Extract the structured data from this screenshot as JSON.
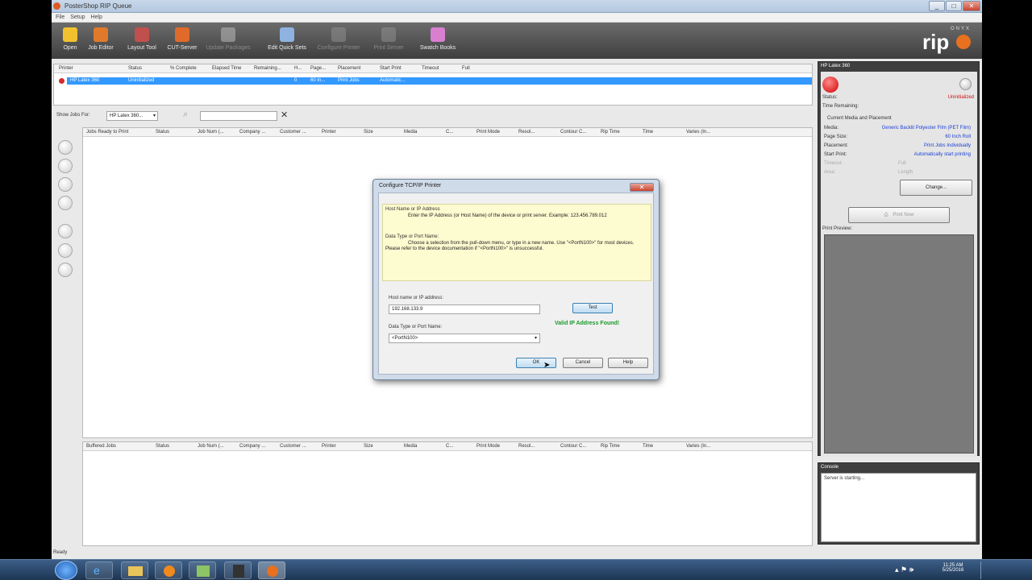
{
  "window": {
    "title": "PosterShop RIP Queue",
    "min": "_",
    "max": "□",
    "close": "✕"
  },
  "menu": [
    "File",
    "Setup",
    "Help"
  ],
  "toolbar": [
    {
      "label": "Open",
      "icon": "folder-icon",
      "color": "#f2c12e",
      "enabled": true
    },
    {
      "label": "Job Editor",
      "icon": "job-editor-icon",
      "color": "#e07a2a",
      "enabled": true
    },
    {
      "label": "Layout Tool",
      "icon": "layout-tool-icon",
      "color": "#c0504d",
      "enabled": true
    },
    {
      "label": "CUT-Server",
      "icon": "cut-server-icon",
      "color": "#e06a2a",
      "enabled": true
    },
    {
      "label": "Update Packages",
      "icon": "update-packages-icon",
      "color": "#cfcfcf",
      "enabled": false
    },
    {
      "label": "Edit Quick Sets",
      "icon": "quick-sets-icon",
      "color": "#8fb3e0",
      "enabled": true
    },
    {
      "label": "Configure Printer",
      "icon": "printer-icon",
      "color": "#9a9a9a",
      "enabled": false
    },
    {
      "label": "Print Server",
      "icon": "print-server-icon",
      "color": "#9a9a9a",
      "enabled": false
    },
    {
      "label": "Swatch Books",
      "icon": "swatch-books-icon",
      "color": "#d87fd0",
      "enabled": true
    }
  ],
  "logo": {
    "brand": "ONYX",
    "product": "rip"
  },
  "printer_table": {
    "headers": [
      "Printer",
      "Status",
      "% Complete",
      "Elapsed Time",
      "Remaining...",
      "H...",
      "Page...",
      "Placement",
      "Start Print",
      "Timeout",
      "Full"
    ],
    "rows": [
      [
        "HP Latex 360",
        "Uninitialized",
        "",
        "",
        "",
        "0",
        "60 In...",
        "Print Jobs",
        "Automatic...",
        "",
        ""
      ]
    ]
  },
  "filter": {
    "label": "Show Jobs For:",
    "selected": "HP Latex 360...",
    "search_value": ""
  },
  "ready_table": {
    "headers": [
      "Jobs Ready to Print",
      "Status",
      "Job Num (...",
      "Company ...",
      "Customer ...",
      "Printer",
      "Size",
      "Media",
      "C...",
      "Print Mode",
      "Resol...",
      "Contour C...",
      "Rip Time",
      "Time",
      "Varies (In..."
    ]
  },
  "buffered_table": {
    "headers": [
      "Buffered Jobs",
      "Status",
      "Job Num (...",
      "Company ...",
      "Customer ...",
      "Printer",
      "Size",
      "Media",
      "C...",
      "Print Mode",
      "Resol...",
      "Contour C...",
      "Rip Time",
      "Time",
      "Varies (In..."
    ]
  },
  "status_bar": "Ready",
  "printer_panel": {
    "title": "HP Latex 360",
    "status_label": "Status:",
    "status_value": "Uninitialized",
    "time_remaining_label": "Time Remaining:",
    "section": "Current Media and Placement",
    "media_label": "Media:",
    "media_value": "Generic Backlit Polyester Film (PET Film)",
    "page_size_label": "Page Size:",
    "page_size_value": "60 Inch Roll",
    "placement_label": "Placement:",
    "placement_value": "Print Jobs Individually",
    "start_print_label": "Start Print:",
    "start_print_value": "Automatically start printing",
    "timeout_label": "Timeout:",
    "timeout_value": "Full",
    "area_label": "Area:",
    "area_value": "Length",
    "change_button": "Change...",
    "print_now_button": "Print Now",
    "preview_label": "Print Preview:"
  },
  "console": {
    "title": "Console",
    "text": "Server is starting..."
  },
  "dialog": {
    "title": "Configure TCP/IP Printer",
    "close": "✕",
    "help_heading1": "Host Name or IP Address",
    "help_text1": "Enter the IP Address (or Host Name) of the device or print server.  Example: 123.456.789.012",
    "help_heading2": "Data Type or Port Name:",
    "help_text2": "Choose a selection from the pull-down menu, or type in a new name.  Use \"<PortN100>\" for most devices.  Please refer to the device documentation if \"<PortN100>\" is unsuccessful.",
    "host_label": "Host name or IP address:",
    "host_value": "192.168.133.9",
    "test_button": "Test",
    "valid_message": "Valid IP Address Found!",
    "port_label": "Data Type or Port Name:",
    "port_value": "<PortN100>",
    "ok_button": "OK",
    "cancel_button": "Cancel",
    "help_button": "Help"
  },
  "taskbar": {
    "time": "11:25 AM",
    "date": "5/25/2016"
  }
}
